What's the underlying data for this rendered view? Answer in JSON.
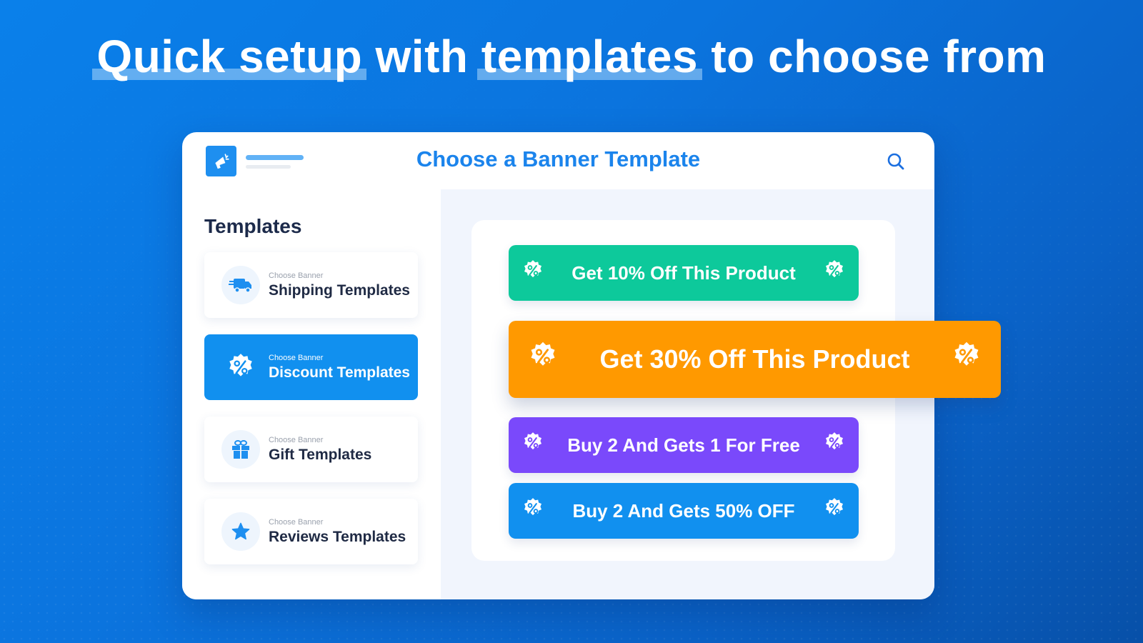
{
  "headline": {
    "part1": "Quick setup",
    "part2": " with ",
    "part3": "templates",
    "part4": " to choose from"
  },
  "window": {
    "title": "Choose a Banner Template",
    "logo_icon": "megaphone-icon",
    "search_icon": "search-icon"
  },
  "sidebar": {
    "title": "Templates",
    "items": [
      {
        "sub": "Choose Banner",
        "label": "Shipping Templates",
        "icon": "truck-icon",
        "active": false
      },
      {
        "sub": "Choose Banner",
        "label": "Discount Templates",
        "icon": "discount-badge-icon",
        "active": true
      },
      {
        "sub": "Choose Banner",
        "label": "Gift Templates",
        "icon": "gift-icon",
        "active": false
      },
      {
        "sub": "Choose Banner",
        "label": "Reviews Templates",
        "icon": "star-icon",
        "active": false
      }
    ]
  },
  "banners": [
    {
      "text": "Get 10% Off  This Product",
      "color": "#0dc99b",
      "icon": "discount-badge-icon"
    },
    {
      "text": "Get 30% Off  This Product",
      "color": "#ff9900",
      "icon": "discount-badge-icon"
    },
    {
      "text": "Buy 2 And Gets 1 For Free",
      "color": "#7a49fb",
      "icon": "discount-badge-icon"
    },
    {
      "text": "Buy 2 And Gets 50% OFF",
      "color": "#1190ef",
      "icon": "discount-badge-icon"
    }
  ],
  "colors": {
    "accent": "#1b84ec",
    "active_item": "#1190ef",
    "text_dark": "#1f2a44"
  }
}
